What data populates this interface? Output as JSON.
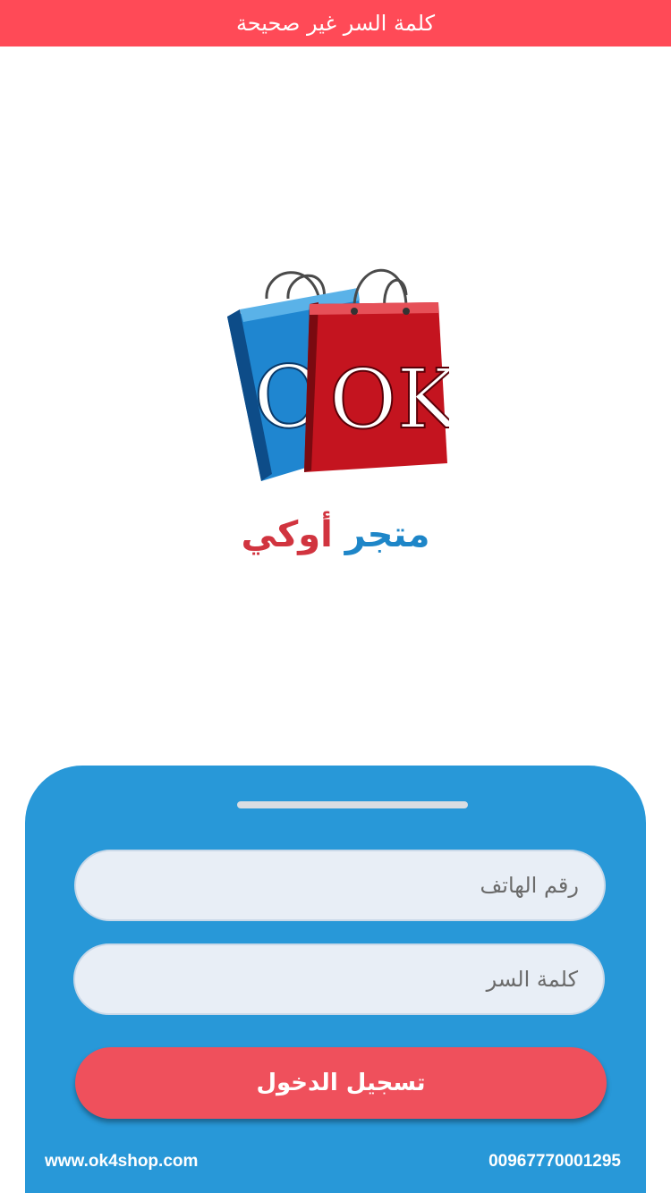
{
  "error_banner": {
    "text": "كلمة السر غير صحيحة",
    "color": "#ff4a57"
  },
  "logo": {
    "text": "OK",
    "blue_bag_color": "#1e7fc4",
    "red_bag_color": "#c4141f"
  },
  "store_name": {
    "word1": "متجر",
    "word2": "أوكي",
    "word1_color": "#1e86c8",
    "word2_color": "#d1343f"
  },
  "form": {
    "phone_placeholder": "رقم الهاتف",
    "password_placeholder": "كلمة السر",
    "login_label": "تسجيل الدخول",
    "panel_color": "#2898d8",
    "button_color": "#ef505c"
  },
  "footer": {
    "website": "www.ok4shop.com",
    "phone": "00967770001295"
  }
}
